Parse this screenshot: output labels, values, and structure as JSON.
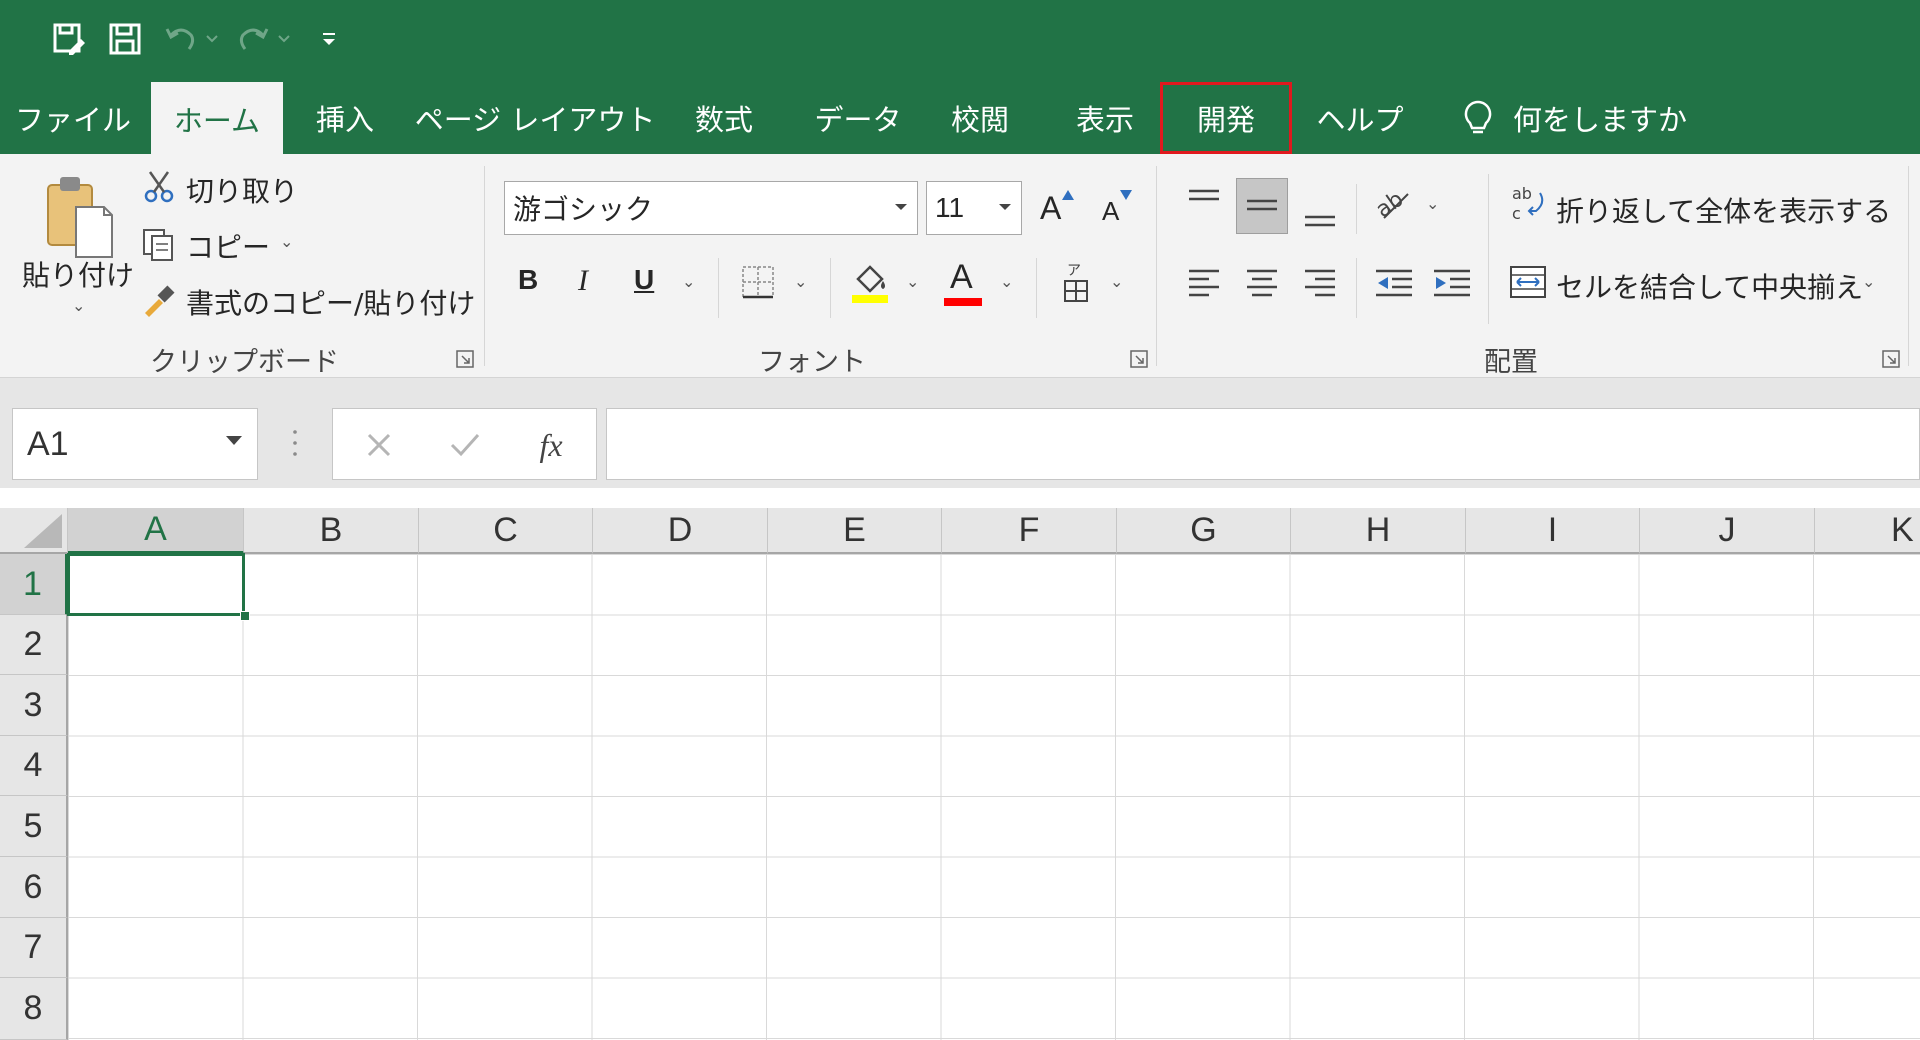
{
  "colors": {
    "brand": "#217346",
    "highlight": "#e0191e",
    "fill_yellow": "#ffff00",
    "font_red": "#ff0000"
  },
  "quick_access": {
    "icons": [
      "autosave-icon",
      "save-icon",
      "undo-icon",
      "redo-icon",
      "customize-icon"
    ]
  },
  "tabs": [
    {
      "label": "ファイル"
    },
    {
      "label": "ホーム",
      "active": true
    },
    {
      "label": "挿入"
    },
    {
      "label": "ページ レイアウト"
    },
    {
      "label": "数式"
    },
    {
      "label": "データ"
    },
    {
      "label": "校閲"
    },
    {
      "label": "表示"
    },
    {
      "label": "開発",
      "highlighted": true
    },
    {
      "label": "ヘルプ"
    }
  ],
  "tell_me": {
    "label": "何をしますか"
  },
  "clipboard": {
    "paste": "貼り付け",
    "cut": "切り取り",
    "copy": "コピー",
    "format_painter": "書式のコピー/貼り付け",
    "group_label": "クリップボード"
  },
  "font": {
    "name": "游ゴシック",
    "size": "11",
    "bold": "B",
    "italic": "I",
    "underline": "U",
    "grow_a": "A",
    "shrink_a": "A",
    "font_color_a": "A",
    "group_label": "フォント"
  },
  "alignment": {
    "wrap_text": "折り返して全体を表示する",
    "merge_center": "セルを結合して中央揃え",
    "group_label": "配置"
  },
  "formula_bar": {
    "name_box": "A1",
    "fx": "fx",
    "value": ""
  },
  "sheet": {
    "columns": [
      "A",
      "B",
      "C",
      "D",
      "E",
      "F",
      "G",
      "H",
      "I",
      "J",
      "K"
    ],
    "rows": [
      "1",
      "2",
      "3",
      "4",
      "5",
      "6",
      "7",
      "8"
    ],
    "active_cell": "A1"
  }
}
